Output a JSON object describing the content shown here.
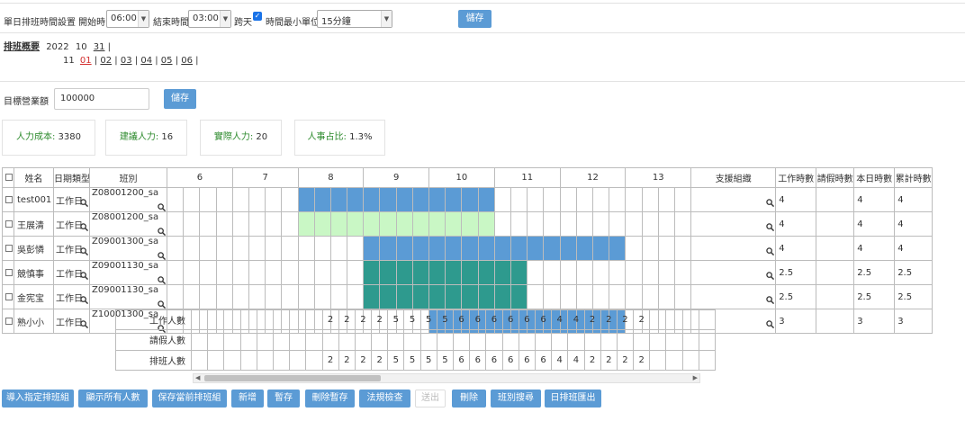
{
  "settings": {
    "label": "單日排班時間設置 開始時間",
    "start_time": "06:00",
    "end_label": "結束時間",
    "end_time": "03:00",
    "nextday_label": "跨天",
    "nextday_checked": true,
    "unit_label": "時間最小單位",
    "unit_value": "15分鐘",
    "save_label": "儲存"
  },
  "schedule_nav": {
    "title": "排班概要",
    "year": "2022",
    "months": [
      {
        "month": "10",
        "days": [
          "31"
        ]
      },
      {
        "month": "11",
        "days": [
          "01",
          "02",
          "03",
          "04",
          "05",
          "06"
        ],
        "active": "01"
      }
    ]
  },
  "revenue": {
    "label": "目標營業額",
    "value": "100000",
    "save_label": "儲存"
  },
  "metrics": [
    {
      "label": "人力成本:",
      "value": "3380"
    },
    {
      "label": "建議人力:",
      "value": "16"
    },
    {
      "label": "實際人力:",
      "value": "20"
    },
    {
      "label": "人事占比:",
      "value": "1.3%"
    }
  ],
  "table": {
    "headers": {
      "name": "姓名",
      "date_type": "日期類型",
      "shift": "班別",
      "support": "支援組織",
      "work_hours": "工作時數",
      "leave_hours": "請假時數",
      "today_hours": "本日時數",
      "cum_hours": "累計時數"
    },
    "hours": [
      "6",
      "7",
      "8",
      "9",
      "10",
      "11",
      "12",
      "13"
    ],
    "slots_per_hour": 4,
    "rows": [
      {
        "name": "test001",
        "date_type": "工作日",
        "shift": "Z08001200_sa",
        "bar_start": 8,
        "bar_end": 20,
        "bar_color": "blue",
        "work": "4",
        "leave": "",
        "today": "4",
        "cum": "4"
      },
      {
        "name": "王展清",
        "date_type": "工作日",
        "shift": "Z08001200_sa",
        "bar_start": 8,
        "bar_end": 20,
        "bar_color": "green",
        "work": "4",
        "leave": "",
        "today": "4",
        "cum": "4"
      },
      {
        "name": "吳彭憐",
        "date_type": "工作日",
        "shift": "Z09001300_sa",
        "bar_start": 12,
        "bar_end": 28,
        "bar_color": "blue",
        "work": "4",
        "leave": "",
        "today": "4",
        "cum": "4"
      },
      {
        "name": "競慎事",
        "date_type": "工作日",
        "shift": "Z09001130_sa",
        "bar_start": 12,
        "bar_end": 22,
        "bar_color": "teal",
        "work": "2.5",
        "leave": "",
        "today": "2.5",
        "cum": "2.5"
      },
      {
        "name": "金宪宝",
        "date_type": "工作日",
        "shift": "Z09001130_sa",
        "bar_start": 12,
        "bar_end": 22,
        "bar_color": "teal",
        "work": "2.5",
        "leave": "",
        "today": "2.5",
        "cum": "2.5"
      },
      {
        "name": "熟小小",
        "date_type": "工作日",
        "shift": "Z10001300_sa",
        "bar_start": 16,
        "bar_end": 28,
        "bar_color": "blue",
        "work": "3",
        "leave": "",
        "today": "3",
        "cum": "3"
      }
    ]
  },
  "counts": {
    "rows": [
      {
        "label": "工作人數",
        "values": [
          "",
          "",
          "",
          "",
          "",
          "",
          "",
          "",
          "2",
          "2",
          "2",
          "2",
          "5",
          "5",
          "5",
          "5",
          "6",
          "6",
          "6",
          "6",
          "6",
          "6",
          "4",
          "4",
          "2",
          "2",
          "2",
          "2",
          "",
          "",
          "",
          ""
        ]
      },
      {
        "label": "請假人數",
        "values": [
          "",
          "",
          "",
          "",
          "",
          "",
          "",
          "",
          "",
          "",
          "",
          "",
          "",
          "",
          "",
          "",
          "",
          "",
          "",
          "",
          "",
          "",
          "",
          "",
          "",
          "",
          "",
          "",
          "",
          "",
          "",
          ""
        ]
      },
      {
        "label": "排班人數",
        "values": [
          "",
          "",
          "",
          "",
          "",
          "",
          "",
          "",
          "2",
          "2",
          "2",
          "2",
          "5",
          "5",
          "5",
          "5",
          "6",
          "6",
          "6",
          "6",
          "6",
          "6",
          "4",
          "4",
          "2",
          "2",
          "2",
          "2",
          "",
          "",
          "",
          ""
        ]
      }
    ]
  },
  "actions": {
    "buttons": [
      {
        "label": "導入指定排班組"
      },
      {
        "label": "顯示所有人數"
      },
      {
        "label": "保存當前排班組"
      },
      {
        "label": "新增"
      },
      {
        "label": "暫存"
      },
      {
        "label": "刪除暫存"
      },
      {
        "label": "法規檢查"
      },
      {
        "label": "送出",
        "disabled": true
      },
      {
        "label": "刪除"
      },
      {
        "label": "班別搜尋"
      },
      {
        "label": "日排班匯出"
      }
    ]
  },
  "colors": {
    "accent": "#5b9bd5",
    "bar_blue": "#5b9bd5",
    "bar_green": "#c9f7c5",
    "bar_teal": "#2e9a8e",
    "metric_label": "#2e8b2e",
    "active_link": "#d32f2f"
  }
}
